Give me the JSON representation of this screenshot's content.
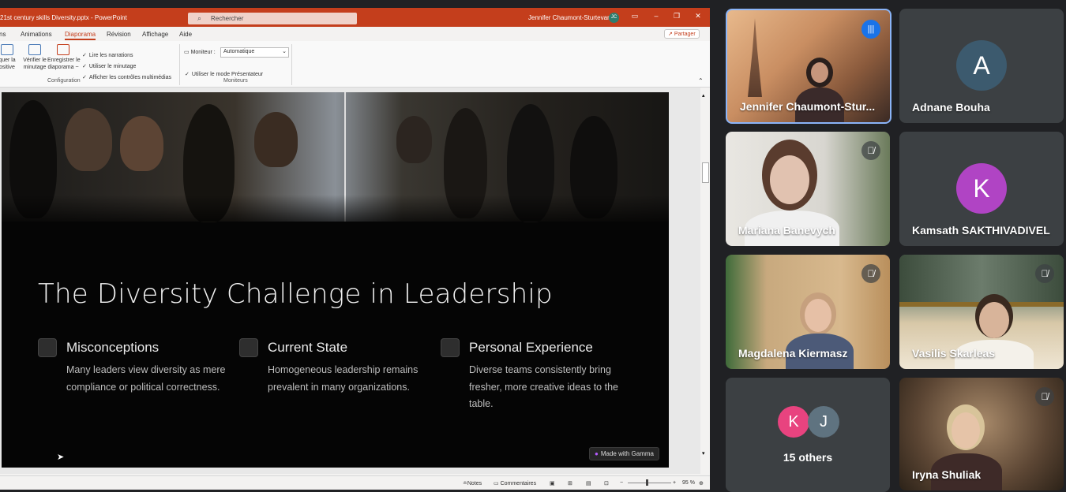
{
  "window": {
    "title": "21st century skills Diversity.pptx  -  PowerPoint",
    "search_icon": "search-icon",
    "search_placeholder": "Rechercher",
    "user_name": "Jennifer Chaumont-Sturtevant",
    "user_initials": "JC"
  },
  "ribbon": {
    "tabs": [
      "ns",
      "Animations",
      "Diaporama",
      "Révision",
      "Affichage",
      "Aide"
    ],
    "active_tab": "Diaporama",
    "share_label": "Partager",
    "buttons": {
      "mask_slide": "quer la\nositive",
      "check_timing": "Vérifier le\nminutage",
      "record_slideshow": "Enregistrer le\ndiaporama ~"
    },
    "checkboxes": [
      "Lire les narrations",
      "Utiliser le minutage",
      "Afficher les contrôles multimédias"
    ],
    "group_configuration": "Configuration",
    "monitor_label": "Moniteur :",
    "monitor_value": "Automatique",
    "presenter_mode": "Utiliser le mode Présentateur",
    "group_monitors": "Moniteurs"
  },
  "slide": {
    "title": "The Diversity Challenge in Leadership",
    "columns": [
      {
        "heading": "Misconceptions",
        "body": "Many leaders view diversity as mere compliance or political correctness."
      },
      {
        "heading": "Current State",
        "body": "Homogeneous leadership remains prevalent in many organizations."
      },
      {
        "heading": "Personal Experience",
        "body": "Diverse teams consistently bring fresher, more creative ideas to the table."
      }
    ],
    "badge": "Made with Gamma"
  },
  "statusbar": {
    "notes": "Notes",
    "comments": "Commentaires",
    "zoom": "95 %"
  },
  "participants": [
    {
      "name": "Jennifer Chaumont-Stur...",
      "speaking": true,
      "video": true
    },
    {
      "name": "Adnane Bouha",
      "initial": "A",
      "avatar_color": "#3c5a6e"
    },
    {
      "name": "Mariana Banevych",
      "muted": true,
      "video": true
    },
    {
      "name": "Kamsath SAKTHIVADIVEL",
      "initial": "K",
      "avatar_color": "#b044c4"
    },
    {
      "name": "Magdalena Kiermasz",
      "muted": true,
      "video": true
    },
    {
      "name": "Vasilis Skarleas",
      "muted": true,
      "video": true
    },
    {
      "name": "15 others",
      "avatars": [
        "K",
        "J"
      ],
      "avatar_colors": [
        "#e8437f",
        "#5f7380"
      ]
    },
    {
      "name": "Iryna Shuliak",
      "muted": true,
      "video": true
    }
  ]
}
